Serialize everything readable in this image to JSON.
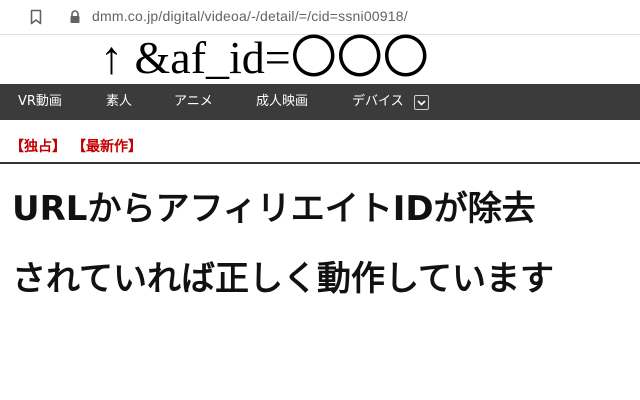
{
  "browser": {
    "url": "dmm.co.jp/digital/videoa/-/detail/=/cid=ssni00918/"
  },
  "annotation": {
    "text": "↑ &af_id=〇〇〇"
  },
  "nav": {
    "items": [
      "VR動画",
      "素人",
      "アニメ",
      "成人映画",
      "デバイス"
    ]
  },
  "tags": [
    "【独占】",
    "【最新作】"
  ],
  "headline": {
    "line1": "URLからアフィリエイトIDが除去",
    "line2": "されていれば正しく動作しています"
  },
  "colors": {
    "nav_background": "#3b3b3b",
    "tag_red": "#c20000",
    "headline": "#111111"
  },
  "icons": [
    "bookmark-icon",
    "lock-icon",
    "chevron-down-icon"
  ]
}
